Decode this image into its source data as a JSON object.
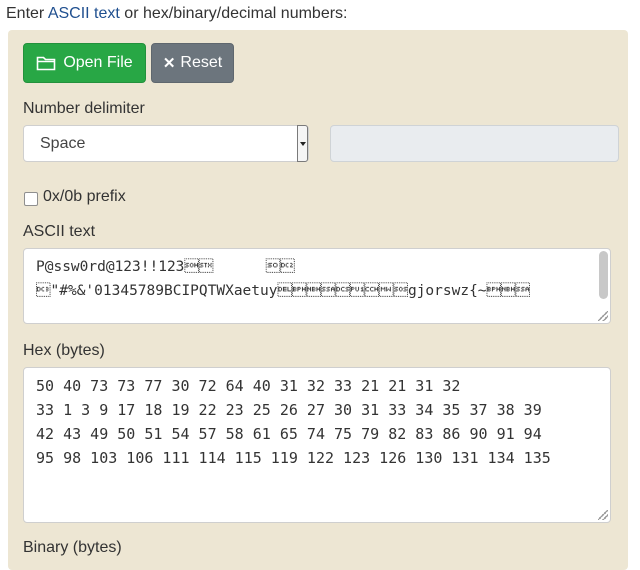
{
  "intro": {
    "prefix": "Enter ",
    "link": "ASCII text",
    "suffix": " or hex/binary/decimal numbers:"
  },
  "buttons": {
    "open_file": "Open File",
    "reset": "Reset"
  },
  "delimiter": {
    "label": "Number delimiter",
    "selected": "Space",
    "custom_value": ""
  },
  "prefix_option": {
    "label": "0x/0b prefix",
    "checked": false
  },
  "ascii": {
    "label": "ASCII text",
    "lines": [
      "P@ssw0rd@123!!123\u0001\u0002      \u000e\u0012",
      "\u0013\"#%&'01345789BCIPQTWXaetuygjorswz{~",
      ""
    ]
  },
  "hex": {
    "label": "Hex (bytes)",
    "lines": [
      "50 40 73 73 77 30 72 64 40 31 32 33 21 21 31 32",
      "33 1 3 9 17 18 19 22 23 25 26 27 30 31 33 34 35 37 38 39",
      "42 43 49 50 51 54 57 58 61 65 74 75 79 82 83 86 90 91 94",
      "95 98 103 106 111 114 115 119 122 123 126 130 131 134 135"
    ]
  },
  "binary": {
    "label": "Binary (bytes)"
  },
  "colors": {
    "panel_bg": "#ede6d3",
    "open_button": "#28a745",
    "reset_button": "#6c757d",
    "link": "#1f4f8f"
  }
}
